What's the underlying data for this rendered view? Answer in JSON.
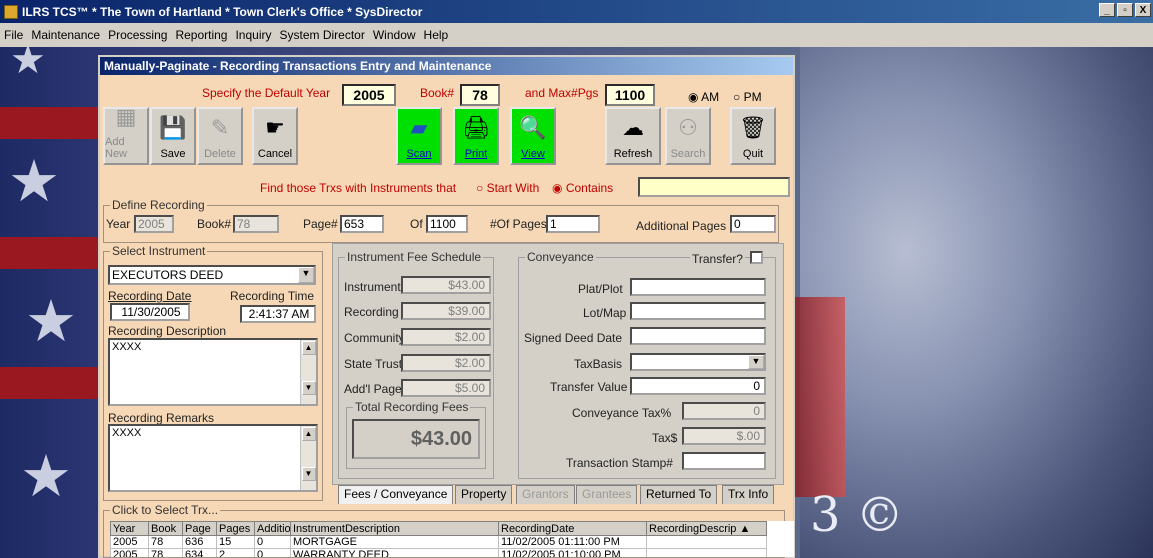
{
  "app": {
    "title": "ILRS TCS™ * The Town of Hartland * Town Clerk's Office * SysDirector",
    "window_controls": [
      "_",
      "▫",
      "X"
    ]
  },
  "menu": [
    "File",
    "Maintenance",
    "Processing",
    "Reporting",
    "Inquiry",
    "System Director",
    "Window",
    "Help"
  ],
  "window": {
    "title": "Manually-Paginate - Recording Transactions Entry and Maintenance"
  },
  "defaults": {
    "year_label": "Specify the Default Year",
    "year": "2005",
    "book_label": "Book#",
    "book": "78",
    "maxpgs_label": "and Max#Pgs",
    "maxpgs": "1100",
    "am_label": "AM",
    "pm_label": "PM",
    "ampm_selected": "AM"
  },
  "toolbar": {
    "add_new": "Add New",
    "save": "Save",
    "delete": "Delete",
    "cancel": "Cancel",
    "scan": "Scan",
    "print": "Print",
    "view": "View",
    "refresh": "Refresh",
    "search": "Search",
    "quit": "Quit"
  },
  "find": {
    "label": "Find those Trxs with Instruments that",
    "start_with": "Start With",
    "contains": "Contains",
    "selected": "Contains",
    "value": ""
  },
  "define": {
    "group_label": "Define Recording",
    "year_label": "Year",
    "year": "2005",
    "book_label": "Book#",
    "book": "78",
    "page_label": "Page#",
    "page": "653",
    "of_label": "Of",
    "of": "1100",
    "num_pages_label": "#Of Pages",
    "num_pages": "1",
    "additional_label": "Additional Pages",
    "additional": "0"
  },
  "instrument": {
    "group_label": "Select Instrument",
    "selected": "EXECUTORS DEED",
    "rec_date_label": "Recording Date",
    "rec_date": "11/30/2005",
    "rec_time_label": "Recording Time",
    "rec_time": "2:41:37 AM",
    "desc_label": "Recording Description",
    "desc": "XXXX",
    "remarks_label": "Recording Remarks",
    "remarks": "XXXX"
  },
  "fees": {
    "group_label": "Instrument Fee Schedule",
    "instrument_label": "Instrument",
    "instrument": "$43.00",
    "recording_label": "Recording",
    "recording": "$39.00",
    "community_label": "Community",
    "community": "$2.00",
    "state_trust_label": "State Trust",
    "state_trust": "$2.00",
    "addl_page_label": "Add'l Page",
    "addl_page": "$5.00",
    "total_label": "Total Recording Fees",
    "total": "$43.00"
  },
  "conveyance": {
    "group_label": "Conveyance",
    "transfer_label": "Transfer?",
    "plat_label": "Plat/Plot",
    "lot_label": "Lot/Map",
    "signed_label": "Signed Deed Date",
    "taxbasis_label": "TaxBasis",
    "transfer_value_label": "Transfer Value",
    "transfer_value": "0",
    "conv_tax_label": "Conveyance Tax%",
    "conv_tax": "0",
    "tax_label": "Tax$",
    "tax": "$.00",
    "stamp_label": "Transaction Stamp#"
  },
  "tabs": [
    "Fees / Conveyance",
    "Property",
    "Grantors",
    "Grantees",
    "Returned To",
    "Trx Info"
  ],
  "trx": {
    "group_label": "Click to Select Trx...",
    "columns": [
      "Year",
      "Book",
      "Page",
      "Pages",
      "Additio",
      "InstrumentDescription",
      "RecordingDate",
      "RecordingDescrip"
    ],
    "rows": [
      [
        "2005",
        "78",
        "636",
        "15",
        "0",
        "MORTGAGE",
        "11/02/2005 01:11:00 PM",
        ""
      ],
      [
        "2005",
        "78",
        "634",
        "2",
        "0",
        "WARRANTY DEED",
        "11/02/2005 01:10:00 PM",
        ""
      ]
    ]
  },
  "wallpaper_text": "3 ©"
}
